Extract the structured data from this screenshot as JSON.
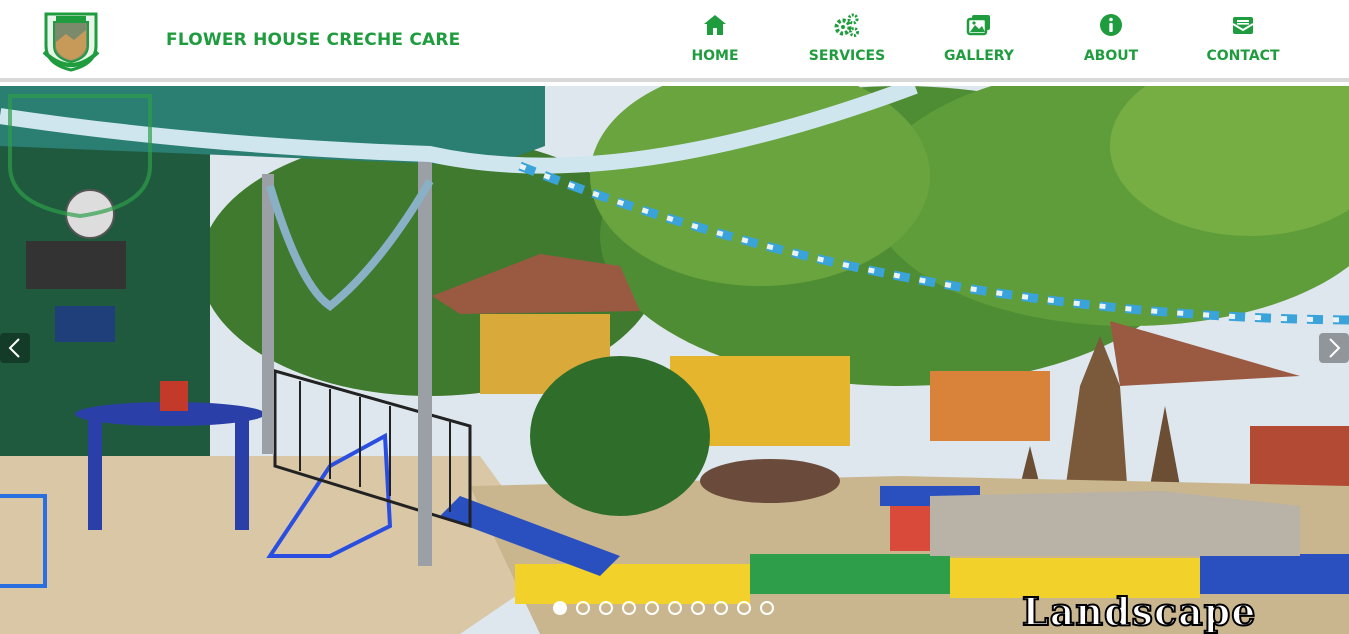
{
  "brand": {
    "name": "FLOWER HOUSE CRECHE CARE",
    "logo_icon": "crest-logo-icon"
  },
  "nav": [
    {
      "label": "HOME",
      "icon": "home-icon"
    },
    {
      "label": "SERVICES",
      "icon": "gears-icon"
    },
    {
      "label": "GALLERY",
      "icon": "images-icon"
    },
    {
      "label": "ABOUT",
      "icon": "info-icon"
    },
    {
      "label": "CONTACT",
      "icon": "envelope-icon"
    }
  ],
  "slider": {
    "caption": "Landscape",
    "total_slides": 10,
    "active_slide": 1,
    "prev_icon": "chevron-left-icon",
    "next_icon": "chevron-right-icon"
  },
  "colors": {
    "brand_green": "#1f9d3e",
    "header_bg": "#ffffff",
    "header_border": "#d8d8d8"
  }
}
